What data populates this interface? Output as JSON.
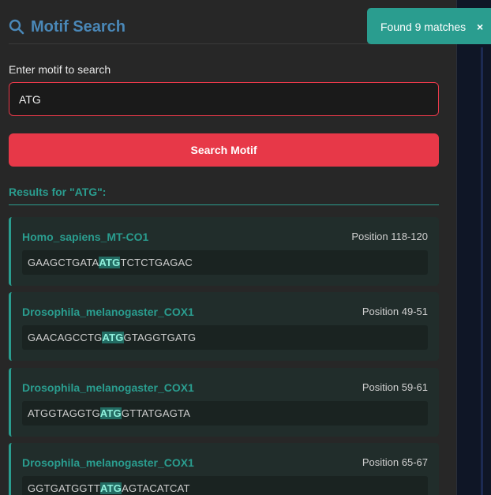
{
  "app": {
    "title": "Motif Search"
  },
  "search": {
    "label": "Enter motif to search",
    "value": "ATG",
    "button_label": "Search Motif"
  },
  "results": {
    "heading": "Results for \"ATG\":",
    "items": [
      {
        "name": "Homo_sapiens_MT-CO1",
        "position": "Position 118-120",
        "before": "GAAGCTGATA",
        "match": "ATG",
        "after": "TCTCTGAGAC"
      },
      {
        "name": "Drosophila_melanogaster_COX1",
        "position": "Position 49-51",
        "before": "GAACAGCCTG",
        "match": "ATG",
        "after": "GTAGGTGATG"
      },
      {
        "name": "Drosophila_melanogaster_COX1",
        "position": "Position 59-61",
        "before": "ATGGTAGGTG",
        "match": "ATG",
        "after": "GTTATGAGTA"
      },
      {
        "name": "Drosophila_melanogaster_COX1",
        "position": "Position 65-67",
        "before": "GGTGATGGTT",
        "match": "ATG",
        "after": "AGTACATCAT"
      }
    ]
  },
  "toast": {
    "message": "Found 9 matches",
    "close_glyph": "×"
  },
  "colors": {
    "accent_teal": "#2a9d8f",
    "accent_red": "#e73848",
    "title_blue": "#4a88b8",
    "panel_bg": "#272727"
  },
  "icons": {
    "search": "search-icon",
    "close": "close-icon"
  }
}
